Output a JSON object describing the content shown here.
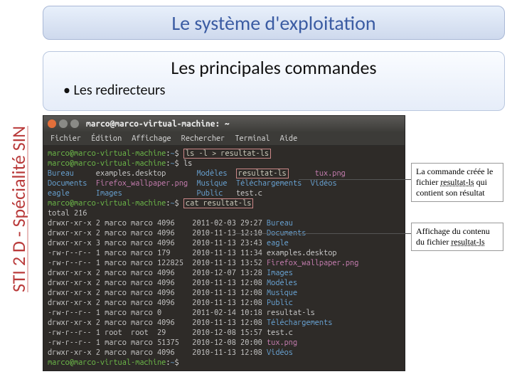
{
  "header": {
    "title": "Le système d'exploitation"
  },
  "sidebar": {
    "label": "STI 2 D  - Spécialité SIN"
  },
  "subheader": {
    "title": "Les principales commandes",
    "bullet": "Les redirecteurs"
  },
  "terminal": {
    "window_title": "marco@marco-virtual-machine: ~",
    "menu": [
      "Fichier",
      "Édition",
      "Affichage",
      "Rechercher",
      "Terminal",
      "Aide"
    ],
    "prompt_user": "marco@marco-virtual-machine",
    "prompt_path": "~",
    "cmd1": "ls -l > resultat-ls",
    "cmd2": "ls",
    "ls_short": {
      "row1": [
        "Bureau",
        "examples.desktop",
        "Modèles",
        "resultat-ls",
        "tux.png"
      ],
      "row2": [
        "Documents",
        "Firefox_wallpaper.png",
        "Musique",
        "Téléchargements",
        "Vidéos"
      ],
      "row3": [
        "eagle",
        "Images",
        "Public",
        "test.c",
        ""
      ]
    },
    "cmd3": "cat resultat-ls",
    "total": "total 216",
    "listing": [
      {
        "perm": "drwxr-xr-x",
        "ln": "2",
        "own": "marco",
        "grp": "marco",
        "size": "4096",
        "date": "2011-02-03 29:27",
        "name": "Bureau",
        "cls": "blue"
      },
      {
        "perm": "drwxr-xr-x",
        "ln": "2",
        "own": "marco",
        "grp": "marco",
        "size": "4096",
        "date": "2010-11-13 12:10",
        "name": "Documents",
        "cls": "blue"
      },
      {
        "perm": "drwxr-xr-x",
        "ln": "3",
        "own": "marco",
        "grp": "marco",
        "size": "4096",
        "date": "2010-11-13 23:43",
        "name": "eagle",
        "cls": "blue"
      },
      {
        "perm": "-rw-r--r--",
        "ln": "1",
        "own": "marco",
        "grp": "marco",
        "size": "179",
        "date": "2010-11-13 11:34",
        "name": "examples.desktop",
        "cls": ""
      },
      {
        "perm": "-rw-r--r--",
        "ln": "1",
        "own": "marco",
        "grp": "marco",
        "size": "122825",
        "date": "2010-11-13 13:52",
        "name": "Firefox_wallpaper.png",
        "cls": "pink"
      },
      {
        "perm": "drwxr-xr-x",
        "ln": "2",
        "own": "marco",
        "grp": "marco",
        "size": "4096",
        "date": "2010-12-07 13:28",
        "name": "Images",
        "cls": "blue"
      },
      {
        "perm": "drwxr-xr-x",
        "ln": "2",
        "own": "marco",
        "grp": "marco",
        "size": "4096",
        "date": "2010-11-13 12:08",
        "name": "Modèles",
        "cls": "blue"
      },
      {
        "perm": "drwxr-xr-x",
        "ln": "2",
        "own": "marco",
        "grp": "marco",
        "size": "4096",
        "date": "2010-11-13 12:08",
        "name": "Musique",
        "cls": "blue"
      },
      {
        "perm": "drwxr-xr-x",
        "ln": "2",
        "own": "marco",
        "grp": "marco",
        "size": "4096",
        "date": "2010-11-13 12:08",
        "name": "Public",
        "cls": "blue"
      },
      {
        "perm": "-rw-r--r--",
        "ln": "1",
        "own": "marco",
        "grp": "marco",
        "size": "0",
        "date": "2011-02-14 10:18",
        "name": "resultat-ls",
        "cls": ""
      },
      {
        "perm": "drwxr-xr-x",
        "ln": "2",
        "own": "marco",
        "grp": "marco",
        "size": "4096",
        "date": "2010-11-13 12:08",
        "name": "Téléchargements",
        "cls": "blue"
      },
      {
        "perm": "-rw-r--r--",
        "ln": "1",
        "own": "root",
        "grp": "root",
        "size": "29",
        "date": "2010-12-08 15:57",
        "name": "test.c",
        "cls": ""
      },
      {
        "perm": "-rw-r--r--",
        "ln": "1",
        "own": "marco",
        "grp": "marco",
        "size": "51375",
        "date": "2010-12-08 20:00",
        "name": "tux.png",
        "cls": "pink"
      },
      {
        "perm": "drwxr-xr-x",
        "ln": "2",
        "own": "marco",
        "grp": "marco",
        "size": "4096",
        "date": "2010-11-13 12:08",
        "name": "Vidéos",
        "cls": "blue"
      }
    ]
  },
  "annotations": {
    "a1_pre": "La commande créée le fichier ",
    "a1_em": "resultat-ls",
    "a1_post": " qui contient son résultat",
    "a2_pre": "Affichage du contenu du fichier ",
    "a2_em": "resultat-ls"
  }
}
